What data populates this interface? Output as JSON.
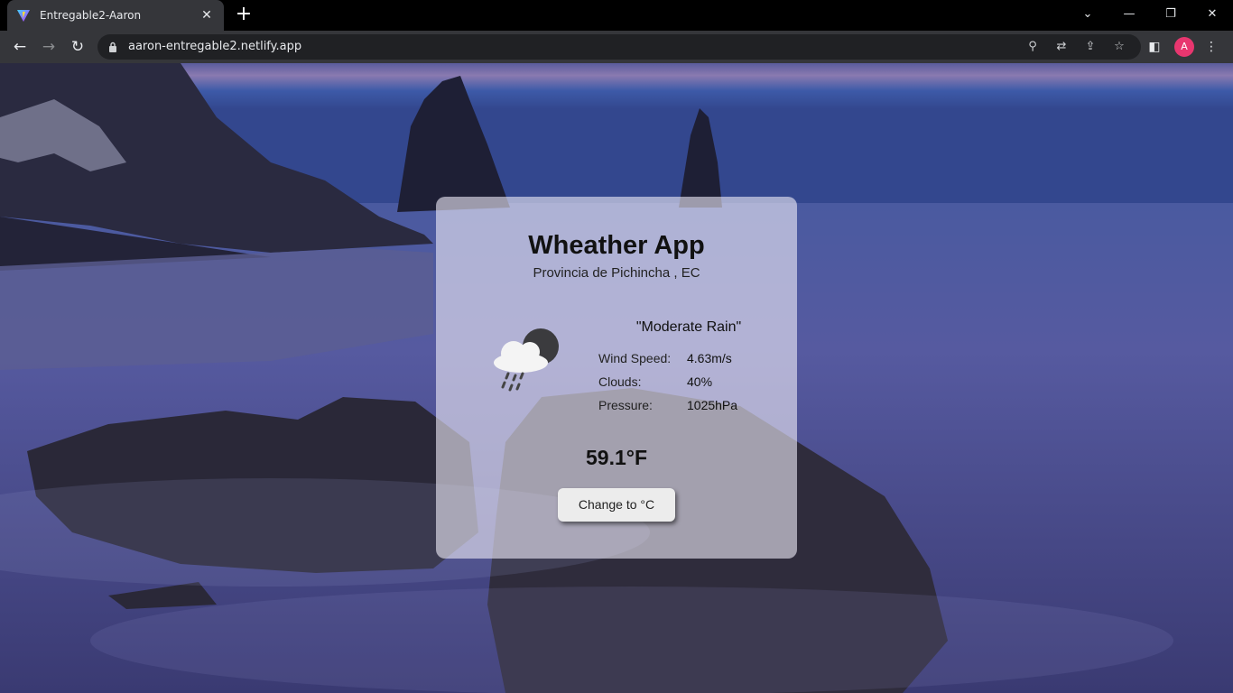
{
  "browser": {
    "tab": {
      "title": "Entregable2-Aaron",
      "close_icon": "close-icon",
      "favicon": "vite-logo-icon"
    },
    "new_tab_label": "+",
    "url": "aaron-entregable2.netlify.app",
    "profile_initial": "A",
    "profile_color": "#e8366f"
  },
  "weather_card": {
    "title": "Wheather App",
    "location": "Provincia de Pichincha , EC",
    "description": "\"Moderate Rain\"",
    "icon": "rain-cloud-night-icon",
    "stats": [
      {
        "label": "Wind Speed:",
        "value": "4.63m/s"
      },
      {
        "label": "Clouds:",
        "value": "40%"
      },
      {
        "label": "Pressure:",
        "value": "1025hPa"
      }
    ],
    "temperature": "59.1°F",
    "toggle_button_label": "Change to °C"
  }
}
